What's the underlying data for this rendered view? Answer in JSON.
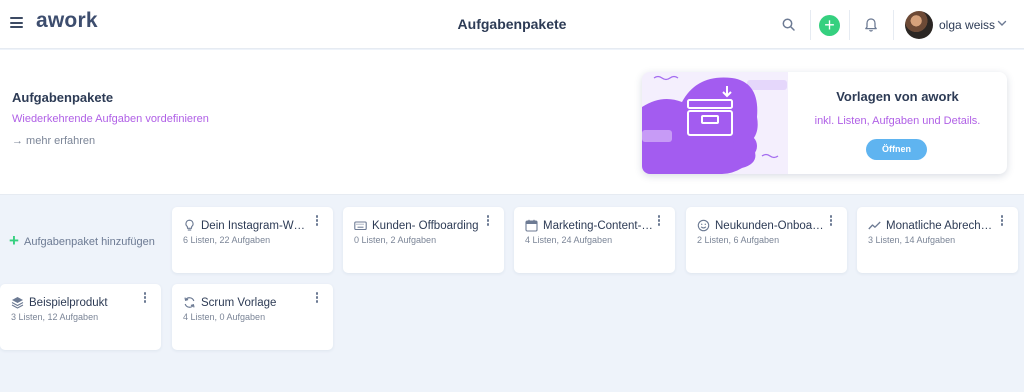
{
  "topbar": {
    "logo": "awork",
    "title": "Aufgabenpakete",
    "user_name": "olga weiss",
    "add_label": "+"
  },
  "header": {
    "title": "Aufgabenpakete",
    "subtitle": "Wiederkehrende Aufgaben vordefinieren",
    "more_link": "→ mehr erfahren"
  },
  "promo": {
    "title": "Vorlagen von awork",
    "text": "inkl. Listen, Aufgaben und Details.",
    "button": "Öffnen"
  },
  "add_card": {
    "plus": "+",
    "label": "Aufgabenpaket hinzufügen"
  },
  "cards": [
    {
      "title": "Dein Instagram-Wo…",
      "meta": "6 Listen, 22 Aufgaben",
      "icon": "lightbulb-icon"
    },
    {
      "title": "Kunden- Offboarding",
      "meta": "0 Listen, 2 Aufgaben",
      "icon": "keyboard-icon"
    },
    {
      "title": "Marketing-Content-…",
      "meta": "4 Listen, 24 Aufgaben",
      "icon": "calendar-icon"
    },
    {
      "title": "Neukunden-Onboa…",
      "meta": "2 Listen, 6 Aufgaben",
      "icon": "smiley-icon"
    },
    {
      "title": "Monatliche Abrech…",
      "meta": "3 Listen, 14 Aufgaben",
      "icon": "trend-line-icon"
    },
    {
      "title": "Beispielprodukt",
      "meta": "3 Listen, 12 Aufgaben",
      "icon": "layers-icon"
    },
    {
      "title": "Scrum Vorlage",
      "meta": "4 Listen, 0 Aufgaben",
      "icon": "refresh-icon"
    }
  ],
  "colors": {
    "accent_purple": "#b060e6",
    "add_green": "#35d07f",
    "button_blue": "#5fb4f0",
    "background": "#eef3fa"
  }
}
